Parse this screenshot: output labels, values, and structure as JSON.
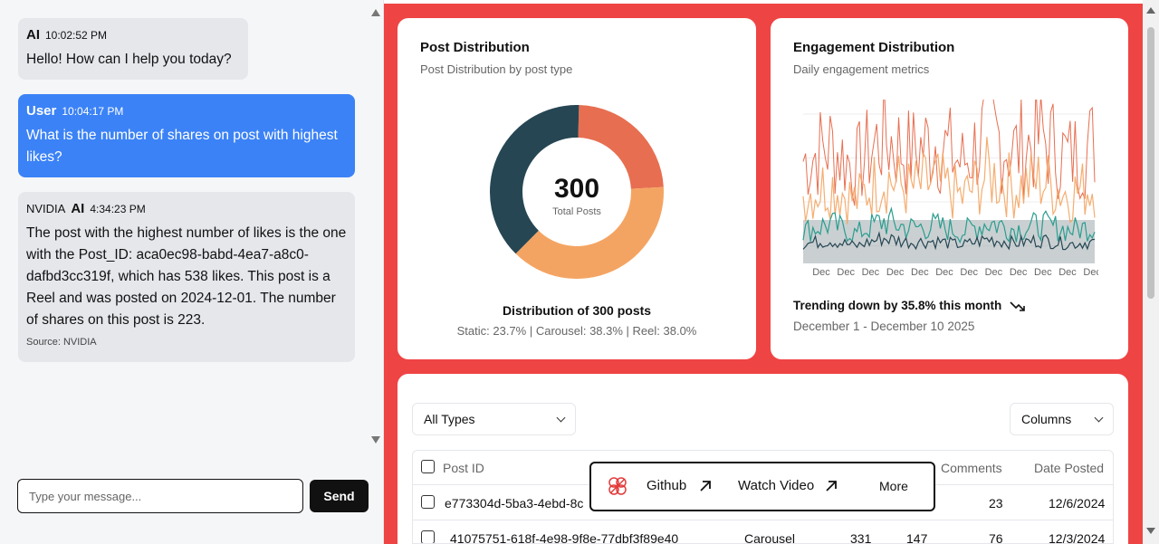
{
  "chat": {
    "messages": [
      {
        "sender": "AI",
        "time": "10:02:52 PM",
        "text": "Hello! How can I help you today?"
      },
      {
        "sender": "User",
        "time": "10:04:17 PM",
        "text": "What is the number of shares on post with highest likes?"
      },
      {
        "vendor": "NVIDIA",
        "sender": "AI",
        "time": "4:34:23 PM",
        "text": "The post with the highest number of likes is the one with the Post_ID: aca0ec98-babd-4ea7-a8c0-dafbd3cc319f, which has 538 likes. This post is a Reel and was posted on 2024-12-01. The number of shares on this post is 223.",
        "source": "Source: NVIDIA"
      }
    ],
    "input_placeholder": "Type your message...",
    "send_label": "Send"
  },
  "post_distribution": {
    "title": "Post Distribution",
    "subtitle": "Post Distribution by post type",
    "center_value": "300",
    "center_label": "Total Posts",
    "footer_title": "Distribution of 300 posts",
    "footer_detail": "Static: 23.7% | Carousel: 38.3% | Reel: 38.0%"
  },
  "engagement_distribution": {
    "title": "Engagement Distribution",
    "subtitle": "Daily engagement metrics",
    "trend_text": "Trending down by 35.8% this month",
    "date_range": "December 1 - December 10 2025",
    "x_tick_label": "Dec"
  },
  "table_controls": {
    "type_filter": "All Types",
    "columns_button": "Columns"
  },
  "table": {
    "headers": {
      "post_id": "Post ID",
      "comments": "Comments",
      "date_posted": "Date Posted"
    },
    "rows": [
      {
        "post_id": "e773304d-5ba3-4ebd-8c",
        "type": "",
        "likes": "",
        "shares": "",
        "comments": "23",
        "date": "12/6/2024"
      },
      {
        "post_id": "41075751-618f-4e98-9f8e-77dbf3f89e40",
        "type": "Carousel",
        "likes": "331",
        "shares": "147",
        "comments": "76",
        "date": "12/3/2024"
      }
    ]
  },
  "popup": {
    "github": "Github",
    "watch_video": "Watch Video",
    "more": "More"
  },
  "chart_data": [
    {
      "type": "pie",
      "title": "Post Distribution",
      "categories": [
        "Static",
        "Carousel",
        "Reel"
      ],
      "values": [
        23.7,
        38.3,
        38.0
      ],
      "colors": [
        "#e76e50",
        "#f4a462",
        "#264653"
      ],
      "center_total": 300
    },
    {
      "type": "line",
      "title": "Engagement Distribution",
      "x": [
        "Dec",
        "Dec",
        "Dec",
        "Dec",
        "Dec",
        "Dec",
        "Dec",
        "Dec",
        "Dec",
        "Dec",
        "Dec",
        "Dec"
      ],
      "series": [
        {
          "color": "#e76e50",
          "values": [
            95,
            110,
            88,
            120,
            102,
            115,
            92,
            125,
            105,
            118,
            98,
            112
          ]
        },
        {
          "color": "#f4a462",
          "values": [
            60,
            72,
            55,
            80,
            66,
            74,
            58,
            82,
            68,
            76,
            62,
            70
          ]
        },
        {
          "color": "#2a9d8f",
          "values": [
            25,
            32,
            22,
            35,
            28,
            30,
            24,
            34,
            27,
            31,
            26,
            29
          ]
        },
        {
          "color": "#264653",
          "values": [
            12,
            16,
            10,
            18,
            14,
            15,
            11,
            17,
            13,
            16,
            12,
            14
          ]
        }
      ],
      "grid": true
    }
  ]
}
